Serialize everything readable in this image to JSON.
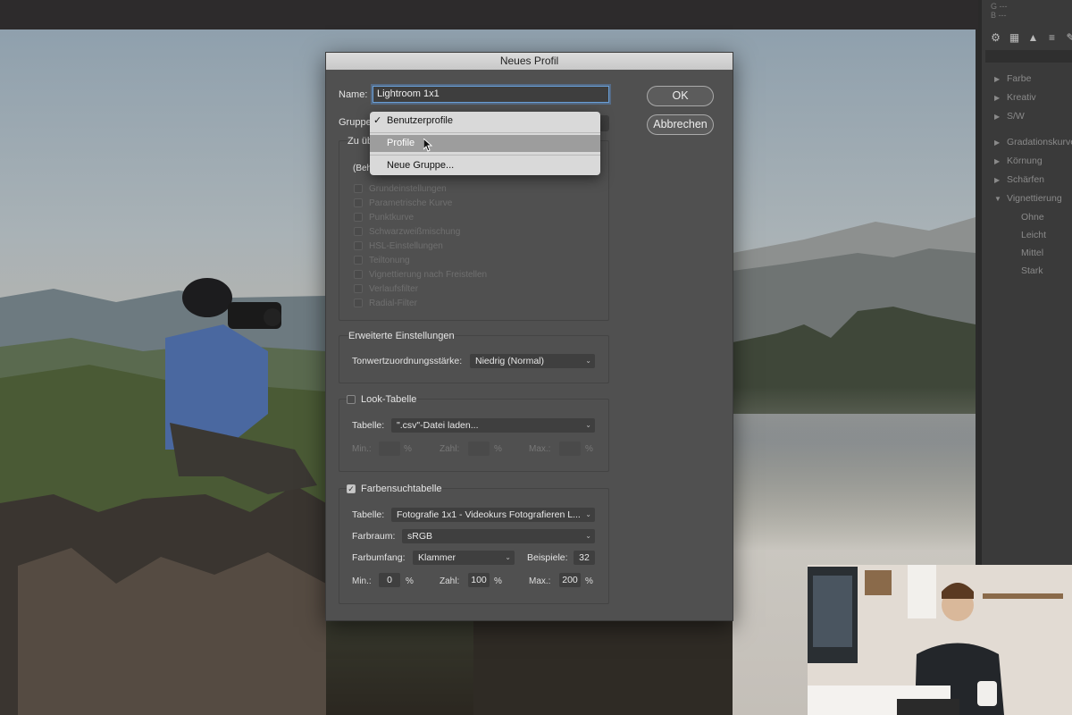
{
  "topbar": {},
  "dialog": {
    "title": "Neues Profil",
    "name_label": "Name:",
    "name_value": "Lightroom 1x1",
    "ok_label": "OK",
    "cancel_label": "Abbrechen",
    "group_label": "Gruppe",
    "settings_box_title": "Zu üb",
    "settings_box_sub": "(Beh",
    "checkboxes": [
      "Grundeinstellungen",
      "Parametrische Kurve",
      "Punktkurve",
      "Schwarzweißmischung",
      "HSL-Einstellungen",
      "Teiltonung",
      "Vignettierung nach Freistellen",
      "Verlaufsfilter",
      "Radial-Filter"
    ],
    "advanced": {
      "title": "Erweiterte Einstellungen",
      "tone_label": "Tonwertzuordnungsstärke:",
      "tone_value": "Niedrig (Normal)"
    },
    "look": {
      "title": "Look-Tabelle",
      "table_label": "Tabelle:",
      "table_value": "\".csv\"-Datei laden...",
      "min_label": "Min.:",
      "count_label": "Zahl:",
      "max_label": "Max.:",
      "pct": "%"
    },
    "lut": {
      "title": "Farbensuchtabelle",
      "checked": true,
      "table_label": "Tabelle:",
      "table_value": "Fotografie 1x1 - Videokurs Fotografieren L...",
      "space_label": "Farbraum:",
      "space_value": "sRGB",
      "gamut_label": "Farbumfang:",
      "gamut_value": "Klammer",
      "samples_label": "Beispiele:",
      "samples_value": "32",
      "min_label": "Min.:",
      "min_value": "0",
      "count_label": "Zahl:",
      "count_value": "100",
      "max_label": "Max.:",
      "max_value": "200",
      "pct": "%"
    }
  },
  "group_menu": {
    "items": [
      "Benutzerprofile",
      "Profile",
      "Neue Gruppe..."
    ],
    "checked_item": "Benutzerprofile",
    "highlighted_item": "Profile"
  },
  "right_panel": {
    "header_lines": [
      "G  ---",
      "B  ---"
    ],
    "items": [
      {
        "label": "Farbe",
        "type": "group",
        "expanded": false
      },
      {
        "label": "Kreativ",
        "type": "group",
        "expanded": false
      },
      {
        "label": "S/W",
        "type": "group",
        "expanded": false
      },
      {
        "label": "Gradationskurve",
        "type": "group",
        "expanded": false
      },
      {
        "label": "Körnung",
        "type": "group",
        "expanded": false
      },
      {
        "label": "Schärfen",
        "type": "group",
        "expanded": false
      },
      {
        "label": "Vignettierung",
        "type": "group",
        "expanded": true
      },
      {
        "label": "Ohne",
        "type": "sub"
      },
      {
        "label": "Leicht",
        "type": "sub"
      },
      {
        "label": "Mittel",
        "type": "sub"
      },
      {
        "label": "Stark",
        "type": "sub"
      }
    ]
  },
  "colors": {
    "dialog_bg": "#505050",
    "focus_ring": "#6aa0d8",
    "menu_bg": "#d9d9d9",
    "menu_highlight": "#9d9d9d"
  }
}
